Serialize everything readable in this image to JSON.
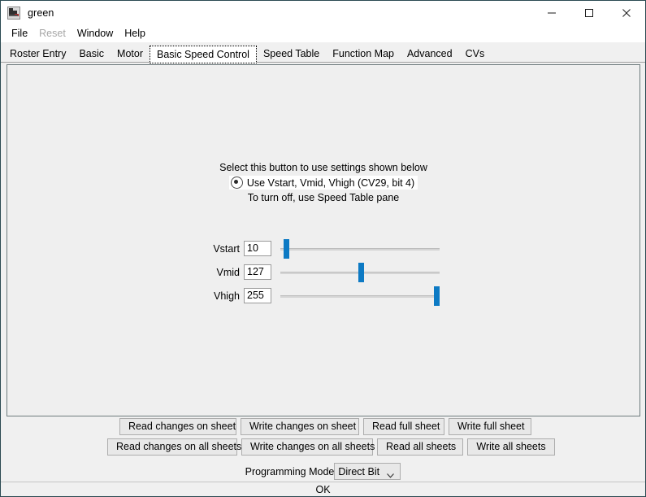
{
  "window": {
    "title": "green",
    "icon": "locomotive-icon",
    "controls": {
      "minimize": "minimize-icon",
      "maximize": "maximize-icon",
      "close": "close-icon"
    }
  },
  "menubar": {
    "items": [
      {
        "label": "File",
        "disabled": false
      },
      {
        "label": "Reset",
        "disabled": true
      },
      {
        "label": "Window",
        "disabled": false
      },
      {
        "label": "Help",
        "disabled": false
      }
    ]
  },
  "tabs": {
    "selected": "Basic Speed Control",
    "items": [
      {
        "label": "Roster Entry",
        "selected": false
      },
      {
        "label": "Basic",
        "selected": false
      },
      {
        "label": "Motor",
        "selected": false
      },
      {
        "label": "Basic Speed Control",
        "selected": true
      },
      {
        "label": "Speed Table",
        "selected": false
      },
      {
        "label": "Function Map",
        "selected": false
      },
      {
        "label": "Advanced",
        "selected": false
      },
      {
        "label": "CVs",
        "selected": false
      }
    ]
  },
  "main": {
    "hint_above": "Select this button to use settings shown below",
    "radio": {
      "label": "Use Vstart, Vmid, Vhigh (CV29, bit 4)",
      "selected": true
    },
    "hint_below": "To turn off, use Speed Table pane",
    "sliders": [
      {
        "label": "Vstart",
        "value": "10",
        "min": 0,
        "max": 255,
        "percent": 3.9
      },
      {
        "label": "Vmid",
        "value": "127",
        "min": 0,
        "max": 255,
        "percent": 49.8
      },
      {
        "label": "Vhigh",
        "value": "255",
        "min": 0,
        "max": 255,
        "percent": 100
      }
    ]
  },
  "actions": {
    "row1": [
      "Read changes on sheet",
      "Write changes on sheet",
      "Read full sheet",
      "Write full sheet"
    ],
    "row2": [
      "Read changes on all sheets",
      "Write changes on all sheets",
      "Read all sheets",
      "Write all sheets"
    ]
  },
  "programming_mode": {
    "label": "Programming Mode",
    "value": "Direct Bit"
  },
  "statusbar": {
    "text": "OK"
  },
  "colors": {
    "accent": "#0d7ac4",
    "panel": "#efefef",
    "window": "#f0f0f0",
    "button": "#e8e8e8"
  }
}
